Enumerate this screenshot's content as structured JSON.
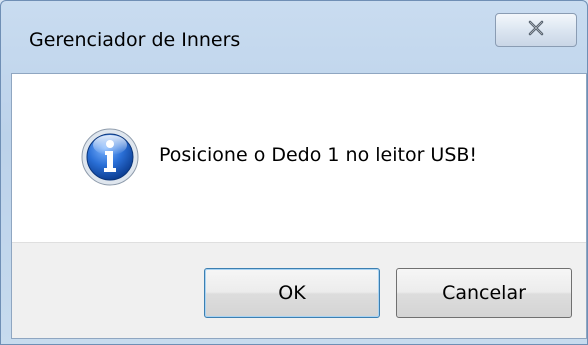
{
  "window": {
    "title": "Gerenciador de Inners",
    "close_icon": "close-icon"
  },
  "message": {
    "icon": "info-icon",
    "text": "Posicione o Dedo 1 no leitor USB!"
  },
  "buttons": {
    "ok_label": "OK",
    "cancel_label": "Cancelar"
  },
  "colors": {
    "title_bar": "#bcd2ea",
    "button_area": "#f0f0f0",
    "info_icon": "#1f5fbf"
  }
}
